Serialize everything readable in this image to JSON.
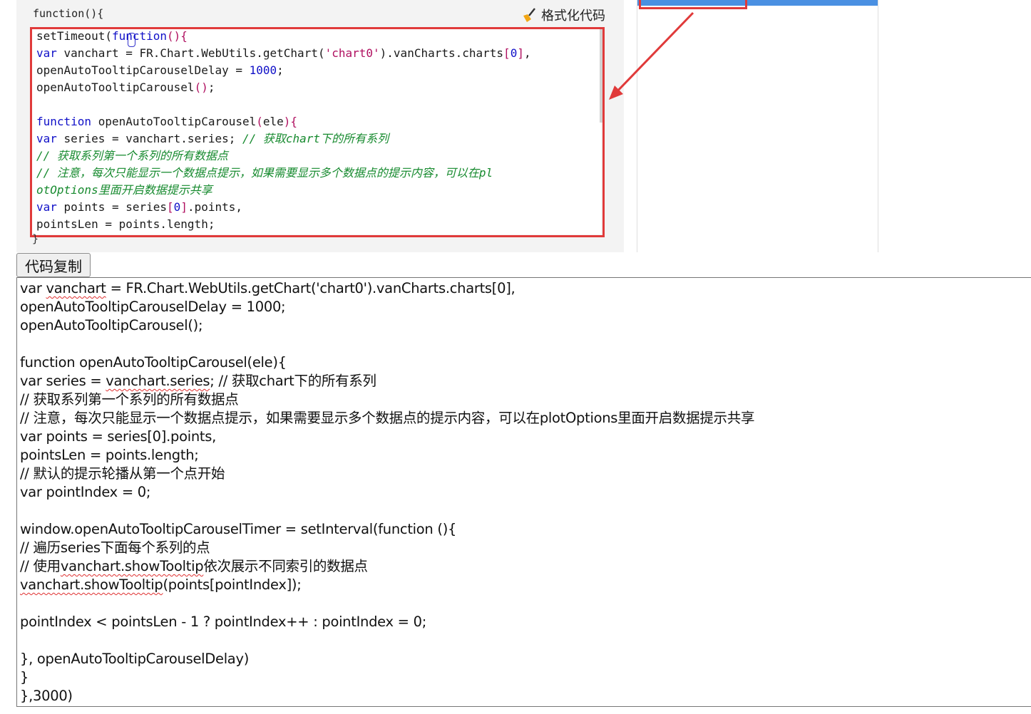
{
  "screenshot": {
    "header_text": "function(){",
    "format_button": "格式化代码",
    "closing_brace": "}",
    "code_lines": [
      [
        {
          "t": "setTimeout(",
          "c": ""
        },
        {
          "t": "function",
          "c": "k"
        },
        {
          "t": "(){",
          "c": "p"
        }
      ],
      [
        {
          "t": "var",
          "c": "k"
        },
        {
          "t": " vanchart = FR.Chart.WebUtils.getChart(",
          "c": ""
        },
        {
          "t": "'chart0'",
          "c": "s"
        },
        {
          "t": ").vanCharts.charts",
          "c": ""
        },
        {
          "t": "[",
          "c": "p"
        },
        {
          "t": "0",
          "c": "n"
        },
        {
          "t": "]",
          "c": "p"
        },
        {
          "t": ",",
          "c": ""
        }
      ],
      [
        {
          "t": "openAutoTooltipCarouselDelay = ",
          "c": ""
        },
        {
          "t": "1000",
          "c": "n"
        },
        {
          "t": ";",
          "c": ""
        }
      ],
      [
        {
          "t": "openAutoTooltipCarousel",
          "c": ""
        },
        {
          "t": "()",
          "c": "p"
        },
        {
          "t": ";",
          "c": ""
        }
      ],
      [],
      [
        {
          "t": "function",
          "c": "k"
        },
        {
          "t": " openAutoTooltipCarousel",
          "c": ""
        },
        {
          "t": "(",
          "c": "p"
        },
        {
          "t": "ele",
          "c": ""
        },
        {
          "t": "){",
          "c": "p"
        }
      ],
      [
        {
          "t": "var",
          "c": "k"
        },
        {
          "t": " series = vanchart.series; ",
          "c": ""
        },
        {
          "t": "// 获取chart下的所有系列",
          "c": "c"
        }
      ],
      [
        {
          "t": "// 获取系列第一个系列的所有数据点",
          "c": "c"
        }
      ],
      [
        {
          "t": "// 注意，每次只能显示一个数据点提示，如果需要显示多个数据点的提示内容，可以在pl",
          "c": "c"
        }
      ],
      [
        {
          "t": "otOptions里面开启数据提示共享",
          "c": "c"
        }
      ],
      [
        {
          "t": "var",
          "c": "k"
        },
        {
          "t": " points = series",
          "c": ""
        },
        {
          "t": "[",
          "c": "p"
        },
        {
          "t": "0",
          "c": "n"
        },
        {
          "t": "]",
          "c": "p"
        },
        {
          "t": ".points,",
          "c": ""
        }
      ],
      [
        {
          "t": "pointsLen = points.length;",
          "c": ""
        }
      ]
    ]
  },
  "copy_button": {
    "label": "代码复制"
  },
  "textarea": {
    "lines": [
      [
        {
          "t": "var "
        },
        {
          "t": "vanchart",
          "sp": true
        },
        {
          "t": " = FR.Chart.WebUtils.getChart('chart0').vanCharts.charts[0],"
        }
      ],
      [
        {
          "t": "openAutoTooltipCarouselDelay = 1000;"
        }
      ],
      [
        {
          "t": "openAutoTooltipCarousel();"
        }
      ],
      [],
      [
        {
          "t": "function openAutoTooltipCarousel(ele){"
        }
      ],
      [
        {
          "t": "var series = "
        },
        {
          "t": "vanchart.series",
          "sp": true
        },
        {
          "t": "; // 获取chart下的所有系列"
        }
      ],
      [
        {
          "t": "// 获取系列第一个系列的所有数据点"
        }
      ],
      [
        {
          "t": "// 注意，每次只能显示一个数据点提示，如果需要显示多个数据点的提示内容，可以在plotOptions里面开启数据提示共享"
        }
      ],
      [
        {
          "t": "var points = series[0].points,"
        }
      ],
      [
        {
          "t": "pointsLen = points.length;"
        }
      ],
      [
        {
          "t": "// 默认的提示轮播从第一个点开始"
        }
      ],
      [
        {
          "t": "var pointIndex = 0;"
        }
      ],
      [],
      [
        {
          "t": "window.openAutoTooltipCarouselTimer = setInterval(function (){"
        }
      ],
      [
        {
          "t": "// 遍历series下面每个系列的点"
        }
      ],
      [
        {
          "t": "// 使用"
        },
        {
          "t": "vanchart.showTooltip",
          "sp": true
        },
        {
          "t": "依次展示不同索引的数据点"
        }
      ],
      [
        {
          "t": "vanchart.showTooltip",
          "sp": true
        },
        {
          "t": "(points[pointIndex]);"
        }
      ],
      [],
      [
        {
          "t": "pointIndex < pointsLen - 1 ? pointIndex++ : pointIndex = 0;"
        }
      ],
      [],
      [
        {
          "t": "}, openAutoTooltipCarouselDelay)"
        }
      ],
      [
        {
          "t": "}"
        }
      ],
      [
        {
          "t": "},3000)"
        }
      ]
    ]
  },
  "colors": {
    "keyword": "#1010c8",
    "string": "#b01060",
    "comment": "#168a2e",
    "highlight_frame": "#e03a3a",
    "panel_band": "#4a90e2"
  }
}
